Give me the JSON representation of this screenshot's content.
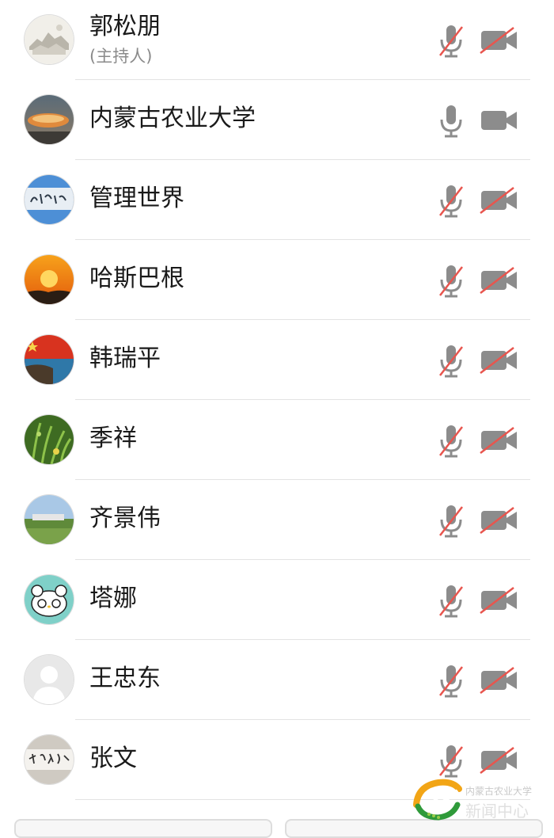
{
  "colors": {
    "icon_gray": "#8c8c8c",
    "slash_red": "#e8554e",
    "text": "#1a1a1a",
    "subtext": "#8a8a8a",
    "divider": "#e3e3e3"
  },
  "participants": [
    {
      "name": "郭松朋",
      "role": "(主持人)",
      "avatar": "landscape-sketch",
      "mic": "muted",
      "camera": "off"
    },
    {
      "name": "内蒙古农业大学",
      "avatar": "sunset-cloud",
      "mic": "on",
      "camera": "on"
    },
    {
      "name": "管理世界",
      "avatar": "calligraphy-blue",
      "mic": "muted",
      "camera": "off"
    },
    {
      "name": "哈斯巴根",
      "avatar": "orange-sun",
      "mic": "muted",
      "camera": "off"
    },
    {
      "name": "韩瑞平",
      "avatar": "flag-coast",
      "mic": "muted",
      "camera": "off"
    },
    {
      "name": "季祥",
      "avatar": "green-plants",
      "mic": "muted",
      "camera": "off"
    },
    {
      "name": "齐景伟",
      "avatar": "grassland",
      "mic": "muted",
      "camera": "off"
    },
    {
      "name": "塔娜",
      "avatar": "hello-kitty",
      "mic": "muted",
      "camera": "off"
    },
    {
      "name": "王忠东",
      "avatar": "default-person",
      "mic": "muted",
      "camera": "off"
    },
    {
      "name": "张文",
      "avatar": "calligraphy-scroll",
      "mic": "muted",
      "camera": "off"
    }
  ],
  "watermark": {
    "line1": "内蒙古农业大学",
    "line2": "新闻中心"
  }
}
